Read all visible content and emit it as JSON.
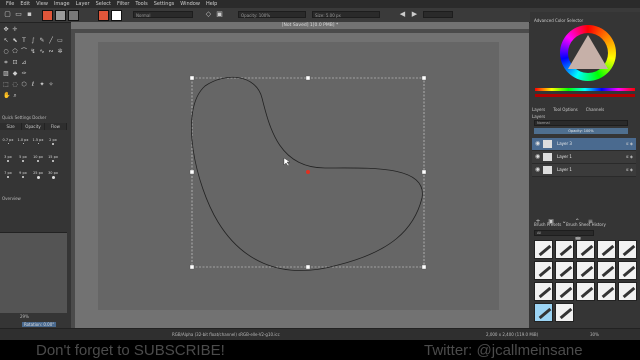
{
  "menubar": [
    "File",
    "Edit",
    "View",
    "Image",
    "Layer",
    "Select",
    "Filter",
    "Tools",
    "Settings",
    "Window",
    "Help"
  ],
  "toolbar": {
    "blend_mode": "Normal",
    "opacity_label": "Opacity: 100%",
    "size_label": "Size: 5.00 px",
    "fg_color": "#e0563a",
    "bg_color": "#ffffff"
  },
  "document": {
    "tab_title": "[Not Saved] 1[0.0 PMB] *",
    "canvas_color": "#666666"
  },
  "quick_settings": {
    "title": "Quick Settings Docker",
    "tabs": [
      "Size",
      "Opacity",
      "Flow"
    ],
    "sizes": [
      "0.7 px",
      "1.0 px",
      "1.5 px",
      "2 px",
      "3 px",
      "5 px",
      "10 px",
      "15 px",
      "7 px",
      "9 px",
      "25 px",
      "30 px"
    ]
  },
  "overview": {
    "title": "Overview",
    "zoom": "29%",
    "rotation": "Rotation: 0.00°"
  },
  "color_selector": {
    "title": "Advanced Color Selector"
  },
  "layers_docker": {
    "tabs": [
      "Layers",
      "Tool Options",
      "Channels"
    ],
    "title": "Layers",
    "blend_mode": "Normal",
    "opacity": "Opacity: 100%",
    "layers": [
      {
        "name": "Layer 3",
        "active": true
      },
      {
        "name": "Layer 1",
        "active": false
      },
      {
        "name": "Layer 1",
        "active": false
      }
    ]
  },
  "brush_presets": {
    "tabs": [
      "Brush Presets",
      "Brush Sheet History"
    ],
    "filter": "All"
  },
  "status": {
    "color_info": "RGB/Alpha (32-bit float/channel)  sRGB-elle-V2-g10.icc",
    "dimensions": "2,000 x 2,400 (119.0 MiB)",
    "zoom": "30%"
  },
  "overlay": {
    "left": "Don't forget to SUBSCRIBE!",
    "right": "Twitter: @jcallmeinsane"
  }
}
